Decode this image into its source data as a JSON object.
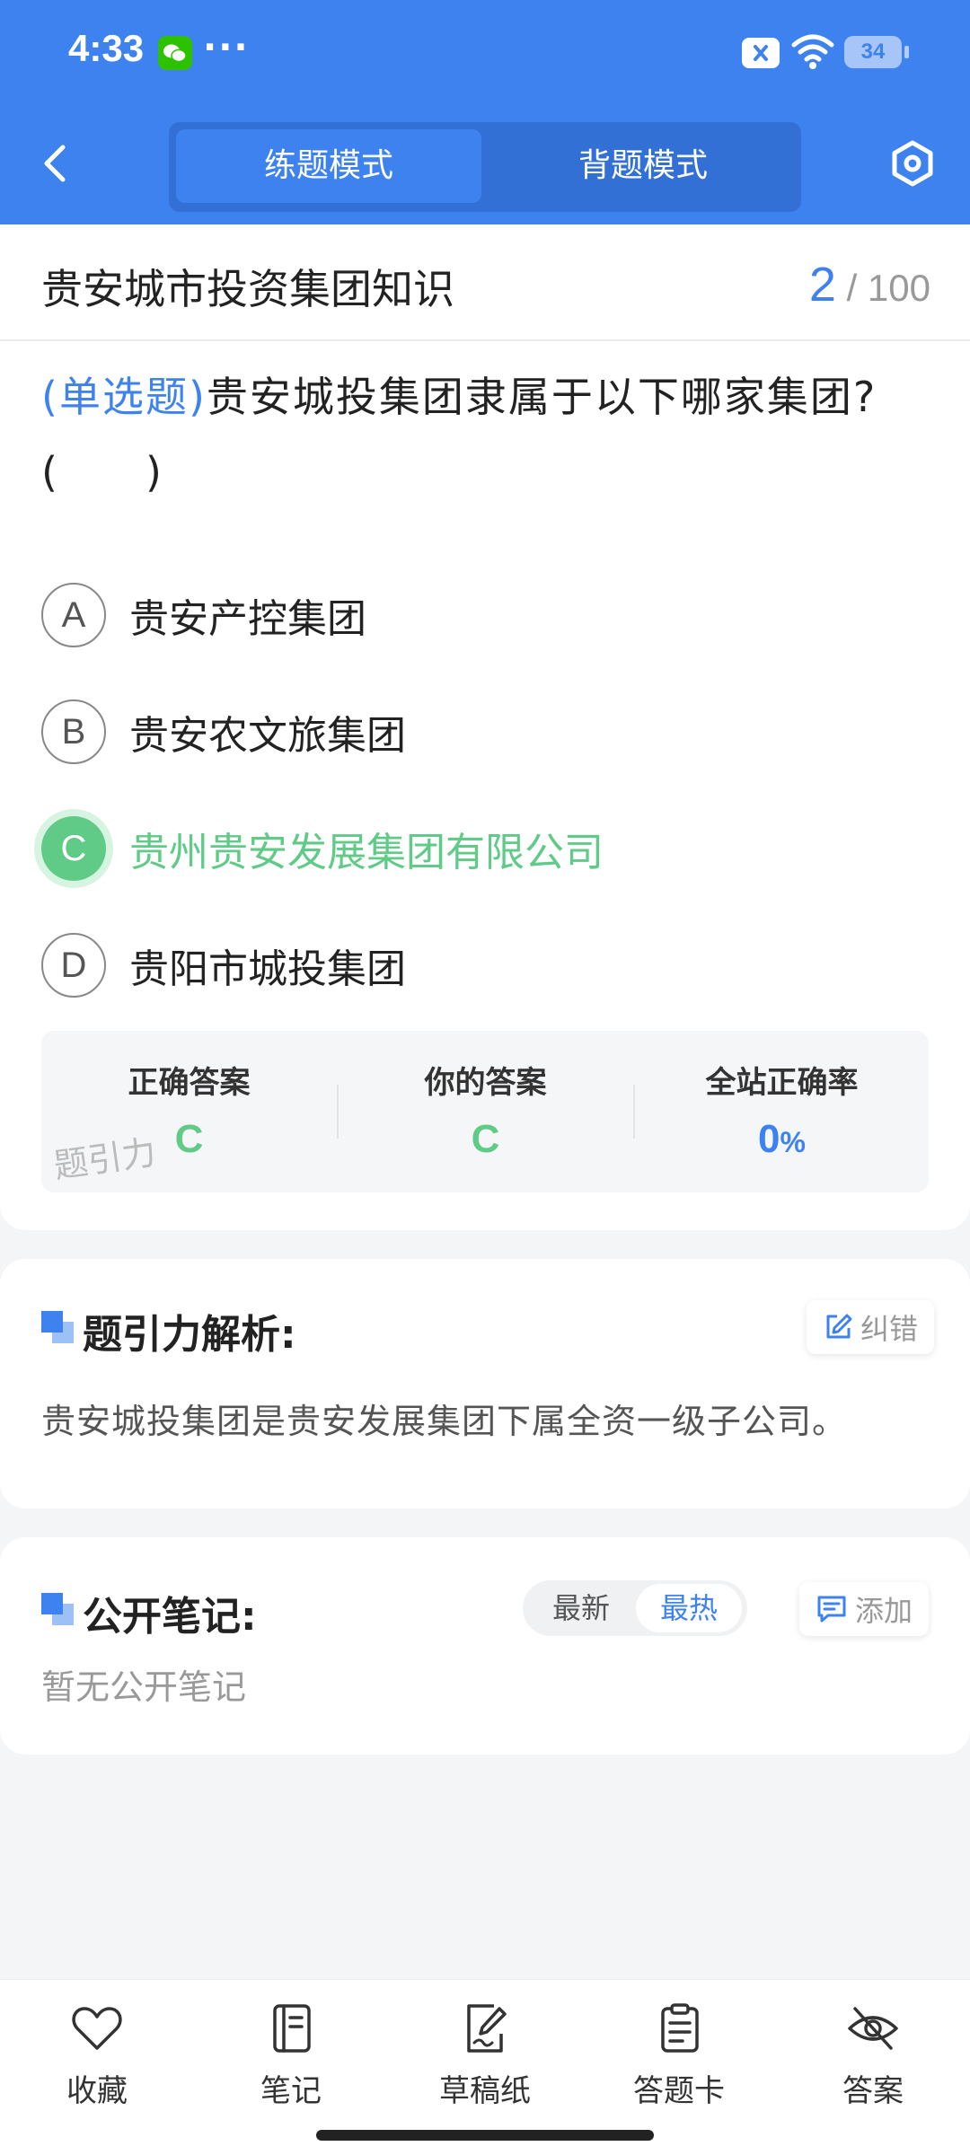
{
  "status_bar": {
    "time": "4:33",
    "dots": "···",
    "battery": "34"
  },
  "header": {
    "modes": [
      {
        "label": "练题模式",
        "active": true
      },
      {
        "label": "背题模式",
        "active": false
      }
    ]
  },
  "paper": {
    "title": "贵安城市投资集团知识",
    "current": "2",
    "separator": "/",
    "total": "100"
  },
  "question": {
    "type": "(单选题)",
    "text": "贵安城投集团隶属于以下哪家集团?",
    "blank": "(　　)",
    "options": [
      {
        "letter": "A",
        "text": "贵安产控集团",
        "state": "normal"
      },
      {
        "letter": "B",
        "text": "贵安农文旅集团",
        "state": "normal"
      },
      {
        "letter": "C",
        "text": "贵州贵安发展集团有限公司",
        "state": "correct"
      },
      {
        "letter": "D",
        "text": "贵阳市城投集团",
        "state": "normal"
      }
    ]
  },
  "answer": {
    "correct_label": "正确答案",
    "correct_value": "C",
    "yours_label": "你的答案",
    "yours_value": "C",
    "rate_label": "全站正确率",
    "rate_value": "0",
    "rate_unit": "%",
    "watermark": "题引力"
  },
  "analysis": {
    "title": "题引力解析:",
    "report_label": "纠错",
    "text": "贵安城投集团是贵安发展集团下属全资一级子公司。"
  },
  "notes": {
    "title": "公开笔记:",
    "sort_newest": "最新",
    "sort_hottest": "最热",
    "add_label": "添加",
    "empty_text": "暂无公开笔记"
  },
  "bottom_bar": [
    {
      "label": "收藏",
      "icon": "heart-icon"
    },
    {
      "label": "笔记",
      "icon": "notebook-icon"
    },
    {
      "label": "草稿纸",
      "icon": "draft-icon"
    },
    {
      "label": "答题卡",
      "icon": "answer-sheet-icon"
    },
    {
      "label": "答案",
      "icon": "eye-off-icon"
    }
  ],
  "colors": {
    "primary": "#3d82ee",
    "correct": "#5fcb87"
  }
}
